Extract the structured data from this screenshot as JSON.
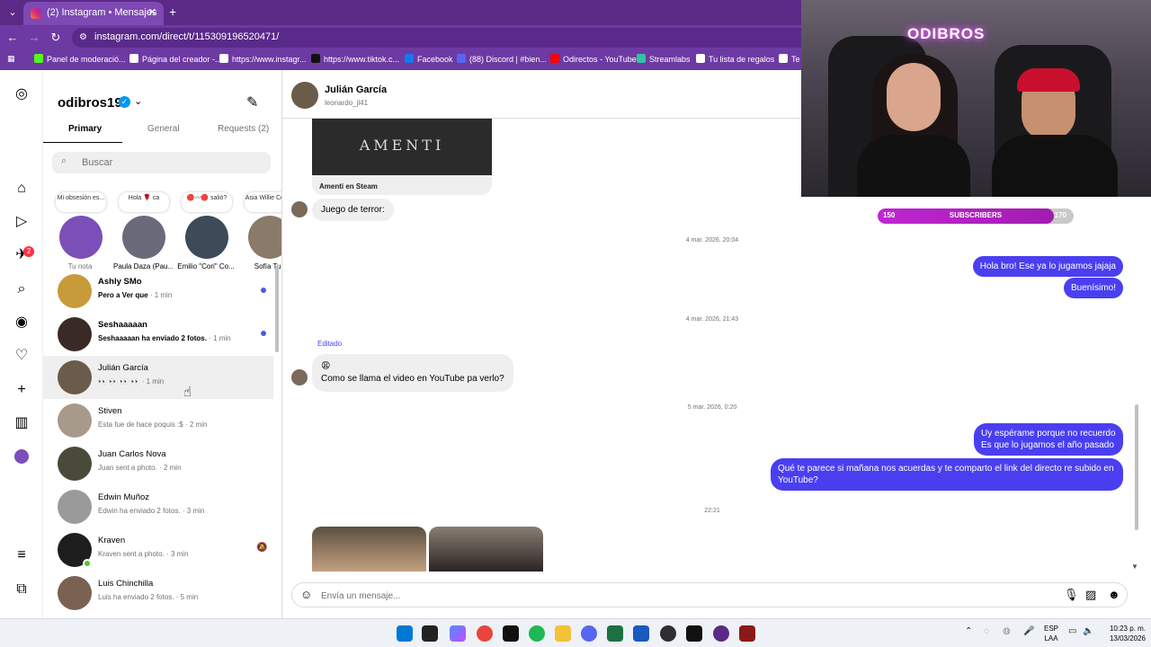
{
  "browser": {
    "tab_title": "(2) Instagram • Mensajes",
    "url": "instagram.com/direct/t/115309196520471/",
    "bookmarks": [
      {
        "label": "Panel de moderació...",
        "icon": "kick-icon",
        "color": "#53fc18"
      },
      {
        "label": "Página del creador -...",
        "icon": "bookmark-icon",
        "color": "#ffffff"
      },
      {
        "label": "https://www.instagr...",
        "icon": "globe-icon",
        "color": "#ffffff"
      },
      {
        "label": "https://www.tiktok.c...",
        "icon": "tiktok-icon",
        "color": "#111111"
      },
      {
        "label": "Facebook",
        "icon": "facebook-icon",
        "color": "#1877f2"
      },
      {
        "label": "(88) Discord | #bien...",
        "icon": "discord-icon",
        "color": "#5865f2"
      },
      {
        "label": "Odirectos - YouTube",
        "icon": "youtube-icon",
        "color": "#ff0000"
      },
      {
        "label": "Streamlabs",
        "icon": "streamlabs-icon",
        "color": "#31c3a2"
      },
      {
        "label": "Tu lista de regalos",
        "icon": "amazon-icon",
        "color": "#ffffff"
      },
      {
        "label": "Te c",
        "icon": "bookmark-icon",
        "color": "#ffffff"
      }
    ]
  },
  "sidebar": {
    "account": "odibros19",
    "badge_count": "2",
    "tabs": [
      "Primary",
      "General",
      "Requests (2)"
    ],
    "search_placeholder": "Buscar"
  },
  "notes": [
    {
      "bubble": "Mi obsesión es...",
      "name": "Tu nota",
      "color": "#7b4fb8"
    },
    {
      "bubble": "Hola 🌹 ca",
      "name": "Paula Daza (Pau...",
      "color": "#6b6a7a"
    },
    {
      "bubble": "🔴〰🔴 salió?",
      "name": "Emilio \"Cori\" Co...",
      "color": "#3d4a57"
    },
    {
      "bubble": "Asia Willie Colón,",
      "name": "Sofía Tur",
      "color": "#8a7a6a"
    }
  ],
  "conversations": [
    {
      "name": "Ashly SMo",
      "preview": "Pero a Ver que",
      "time": "· 1 min",
      "unread": true,
      "bold": true,
      "color": "#c79a3a"
    },
    {
      "name": "Seshaaaaan",
      "preview": "Seshaaaaan ha enviado 2 fotos.",
      "time": "· 1 min",
      "unread": true,
      "bold": true,
      "color": "#3a2a26"
    },
    {
      "name": "Julián García",
      "preview": "👀 👀 👀 👀",
      "time": "· 1 min",
      "unread": false,
      "bold": false,
      "color": "#6b5b4a"
    },
    {
      "name": "Stiven",
      "preview": "Esta fue de hace poquis :$",
      "time": "· 2 min",
      "unread": false,
      "bold": false,
      "color": "#a89a8a"
    },
    {
      "name": "Juan Carlos Nova",
      "preview": "Juan sent a photo.",
      "time": "· 2 min",
      "unread": false,
      "bold": false,
      "color": "#4a4a3a"
    },
    {
      "name": "Edwin Muñoz",
      "preview": "Edwin ha enviado 2 fotos.",
      "time": "· 3 min",
      "unread": false,
      "bold": false,
      "color": "#9a9a9a"
    },
    {
      "name": "Kraven",
      "preview": "Kraven sent a photo.",
      "time": "· 3 min",
      "unread": false,
      "bold": false,
      "color": "#1e1e1e"
    },
    {
      "name": "Luis Chinchilla",
      "preview": "Luis ha enviado 2 fotos.",
      "time": "· 5 min",
      "unread": false,
      "bold": false,
      "color": "#7a6252"
    }
  ],
  "chat": {
    "name": "Julián García",
    "username": "leonardo_jl41",
    "media_image_text": "AMENTI",
    "media_caption": "Amenti en Steam",
    "msg_juego": "Juego de terror:",
    "date_1": "4 mar. 2026, 20:04",
    "out_1": "Hola bro! Ese ya lo jugamos jajaja",
    "out_2": "Buenísimo!",
    "date_2": "4 mar. 2026, 21:43",
    "edited": "Editado",
    "msg_video_emoji": "😩",
    "msg_video": "Como se llama el video  en YouTube pa verlo?",
    "date_3": "5 mar. 2026, 0:20",
    "out_3": "Uy espérame porque no recuerdo Es que lo jugamos el año pasado",
    "out_4": "Qué te parece si mañana nos acuerdas y te comparto el link del directo re subido en YouTube?",
    "date_4": "22:21",
    "composer_placeholder": "Envía un mensaje..."
  },
  "overlay": {
    "neon_sign": "ODIBROS",
    "subs_start": "150",
    "subs_label": "SUBSCRIBERS",
    "subs_end": "170",
    "subs_progress": 0.9
  },
  "taskbar": {
    "lang_1": "ESP",
    "lang_2": "LAA",
    "time": "10:23 p. m.",
    "date": "13/03/2026"
  }
}
